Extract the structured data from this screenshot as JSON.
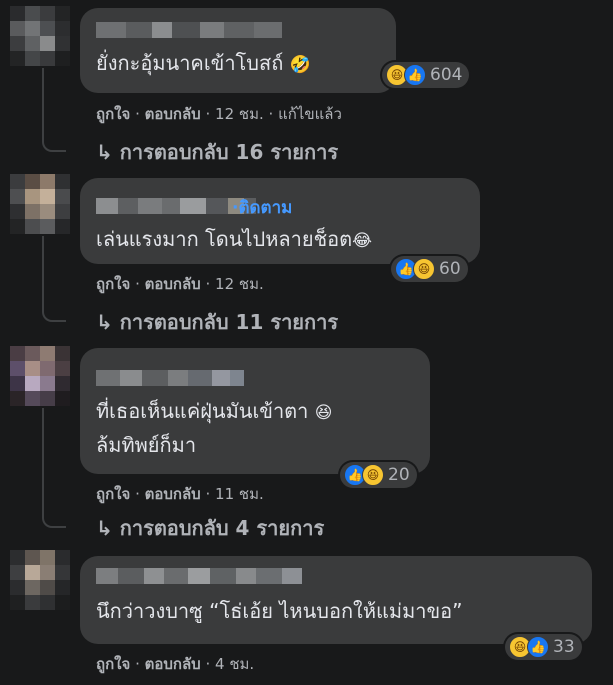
{
  "comments": [
    {
      "text": "ยั่งกะอุ้มนาคเข้าโบสถ์",
      "emoji": "🤣",
      "reaction_icons": [
        "haha-icon",
        "like-icon"
      ],
      "reaction_count": "604",
      "like": "ถูกใจ",
      "reply": "ตอบกลับ",
      "time": "12 ชม.",
      "edited": "แก้ไขแล้ว",
      "replies_text": "การตอบกลับ 16 รายการ"
    },
    {
      "follow": "ติดตาม",
      "text": "เล่นแรงมาก โดนไปหลายช็อต",
      "emoji": "😂",
      "reaction_icons": [
        "like-icon",
        "haha-icon"
      ],
      "reaction_count": "60",
      "like": "ถูกใจ",
      "reply": "ตอบกลับ",
      "time": "12 ชม.",
      "replies_text": "การตอบกลับ 11 รายการ"
    },
    {
      "text_line1": "ที่เธอเห็นแค่ฝุ่นมันเข้าตา",
      "emoji": "😆",
      "text_line2": "ล้มทิพย์ก็มา",
      "reaction_icons": [
        "like-icon",
        "haha-icon"
      ],
      "reaction_count": "20",
      "like": "ถูกใจ",
      "reply": "ตอบกลับ",
      "time": "11 ชม.",
      "replies_text": "การตอบกลับ 4 รายการ"
    },
    {
      "text": "นึกว่าวงบาซู “โธ่เอ้ย ไหนบอกให้แม่มาขอ”",
      "reaction_icons": [
        "haha-icon",
        "like-icon"
      ],
      "reaction_count": "33",
      "like": "ถูกใจ",
      "reply": "ตอบกลับ",
      "time": "4 ชม."
    }
  ],
  "separator": "·",
  "reply_arrow": "↳",
  "colors": {
    "background": "#18191a",
    "bubble": "#3a3b3c",
    "link": "#4599ff",
    "meta": "#b0b3b8"
  }
}
